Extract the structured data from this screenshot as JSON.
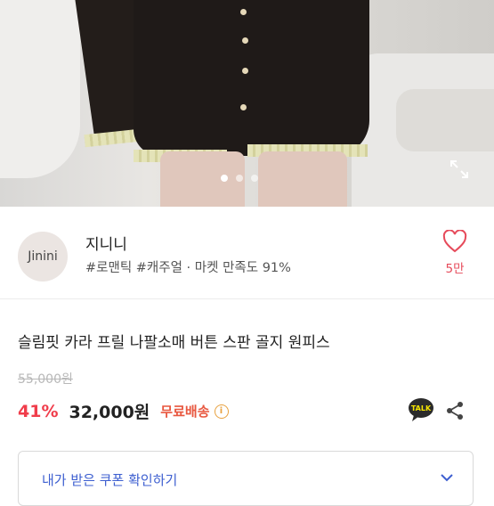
{
  "seller": {
    "avatar_text": "Jinini",
    "name": "지니니",
    "tags": "#로맨틱 #캐주얼 · 마켓 만족도 91%",
    "like_count": "5만"
  },
  "gallery": {
    "page_count": 3,
    "active_index": 0
  },
  "product": {
    "title": "슬림핏 카라 프릴 나팔소매 버튼 스판 골지 원피스",
    "original_price": "55,000원",
    "discount": "41%",
    "price": "32,000원",
    "shipping": "무료배송"
  },
  "talk_badge": "TALK",
  "coupon": {
    "label": "내가 받은 쿠폰 확인하기"
  },
  "colors": {
    "discount": "#f03d4b",
    "shipping": "#e8573f",
    "heart": "#e64a5a",
    "coupon_text": "#3d5fd0"
  },
  "icons": [
    "expand-icon",
    "heart-icon",
    "info-icon",
    "kakao-talk-icon",
    "share-icon",
    "chevron-down-icon"
  ]
}
